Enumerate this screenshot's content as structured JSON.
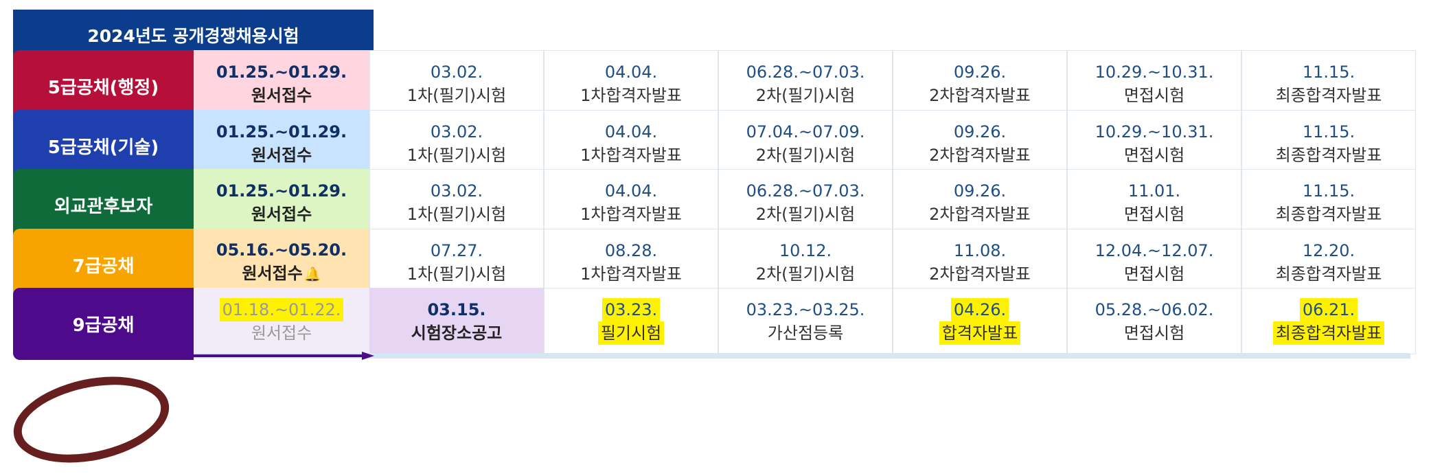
{
  "title": "2024년도 공개경쟁채용시험",
  "rows": [
    {
      "category": "5급공채(행정)",
      "color": "#b5103a",
      "first_bg": "#ffd6df",
      "arrow_color": "#b5103a",
      "cells": [
        {
          "date": "01.25.~01.29.",
          "event": "원서접수"
        },
        {
          "date": "03.02.",
          "event": "1차(필기)시험"
        },
        {
          "date": "04.04.",
          "event": "1차합격자발표"
        },
        {
          "date": "06.28.~07.03.",
          "event": "2차(필기)시험"
        },
        {
          "date": "09.26.",
          "event": "2차합격자발표"
        },
        {
          "date": "10.29.~10.31.",
          "event": "면접시험"
        },
        {
          "date": "11.15.",
          "event": "최종합격자발표"
        }
      ]
    },
    {
      "category": "5급공채(기술)",
      "color": "#1f3faf",
      "first_bg": "#c7e3ff",
      "arrow_color": "#1f3faf",
      "cells": [
        {
          "date": "01.25.~01.29.",
          "event": "원서접수"
        },
        {
          "date": "03.02.",
          "event": "1차(필기)시험"
        },
        {
          "date": "04.04.",
          "event": "1차합격자발표"
        },
        {
          "date": "07.04.~07.09.",
          "event": "2차(필기)시험"
        },
        {
          "date": "09.26.",
          "event": "2차합격자발표"
        },
        {
          "date": "10.29.~10.31.",
          "event": "면접시험"
        },
        {
          "date": "11.15.",
          "event": "최종합격자발표"
        }
      ]
    },
    {
      "category": "외교관후보자",
      "color": "#0f6b3a",
      "first_bg": "#dcf5c2",
      "arrow_color": "#0f6b3a",
      "cells": [
        {
          "date": "01.25.~01.29.",
          "event": "원서접수"
        },
        {
          "date": "03.02.",
          "event": "1차(필기)시험"
        },
        {
          "date": "04.04.",
          "event": "1차합격자발표"
        },
        {
          "date": "06.28.~07.03.",
          "event": "2차(필기)시험"
        },
        {
          "date": "09.26.",
          "event": "2차합격자발표"
        },
        {
          "date": "11.01.",
          "event": "면접시험"
        },
        {
          "date": "11.15.",
          "event": "최종합격자발표"
        }
      ]
    },
    {
      "category": "7급공채",
      "color": "#f7a300",
      "first_bg": "#ffe3b0",
      "arrow_color": "#f7a300",
      "cells": [
        {
          "date": "05.16.~05.20.",
          "event": "원서접수"
        },
        {
          "date": "07.27.",
          "event": "1차(필기)시험"
        },
        {
          "date": "08.28.",
          "event": "1차합격자발표"
        },
        {
          "date": "10.12.",
          "event": "2차(필기)시험"
        },
        {
          "date": "11.08.",
          "event": "2차합격자발표"
        },
        {
          "date": "12.04.~12.07.",
          "event": "면접시험"
        },
        {
          "date": "12.20.",
          "event": "최종합격자발표"
        }
      ]
    },
    {
      "category": "9급공채",
      "color": "#4d0a8a",
      "first_bg": "#f1ecf7",
      "second_bg": "#e6d6f3",
      "arrow_color": "#4d0a8a",
      "cells": [
        {
          "date": "01.18.~01.22.",
          "event": "원서접수"
        },
        {
          "date": "03.15.",
          "event": "시험장소공고"
        },
        {
          "date": "03.23.",
          "event": "필기시험"
        },
        {
          "date": "03.23.~03.25.",
          "event": "가산점등록"
        },
        {
          "date": "04.26.",
          "event": "합격자발표"
        },
        {
          "date": "05.28.~06.02.",
          "event": "면접시험"
        },
        {
          "date": "06.21.",
          "event": "최종합격자발표"
        }
      ]
    }
  ]
}
